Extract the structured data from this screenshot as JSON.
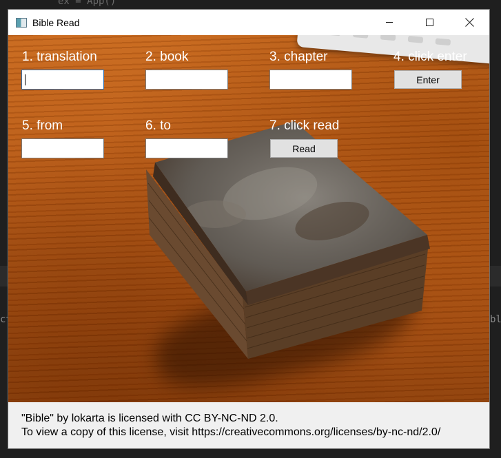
{
  "background": {
    "code_top": "ex = App()"
  },
  "window": {
    "title": "Bible Read",
    "controls": {
      "minimize_icon": "minimize-icon",
      "maximize_icon": "maximize-icon",
      "close_icon": "close-icon"
    }
  },
  "form": {
    "translation_label": "1. translation",
    "book_label": "2. book",
    "chapter_label": "3. chapter",
    "enter_step_label": "4. click enter",
    "enter_button": "Enter",
    "from_label": "5. from",
    "to_label": "6. to",
    "read_step_label": "7. click read",
    "read_button": "Read",
    "translation_value": "",
    "book_value": "",
    "chapter_value": "",
    "from_value": "",
    "to_value": ""
  },
  "license": {
    "line1": "\"Bible\" by lokarta is licensed with CC BY-NC-ND 2.0.",
    "line2": "To view a copy of this license, visit https://creativecommons.org/licenses/by-nc-nd/2.0/"
  },
  "colors": {
    "wood": "#b85a16",
    "label_text": "#ffffff",
    "window_bg": "#f0f0f0"
  }
}
